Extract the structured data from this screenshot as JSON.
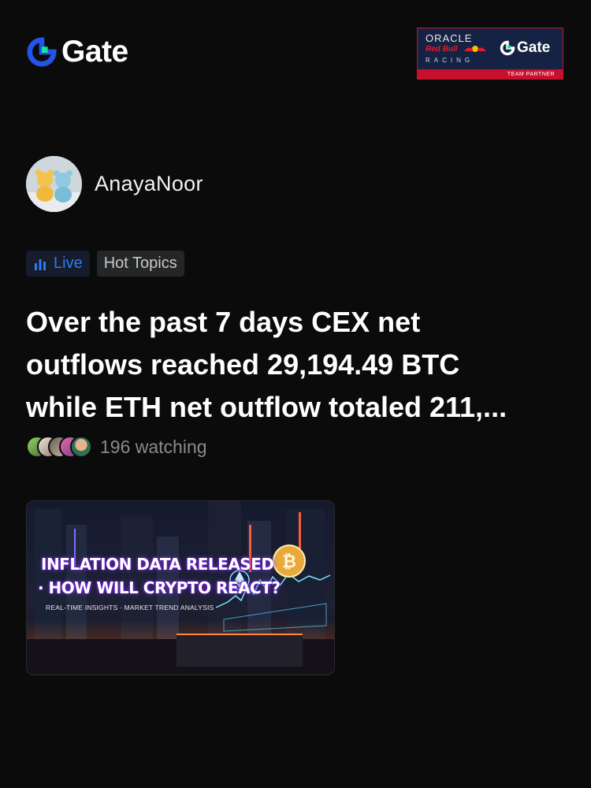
{
  "brand": {
    "name": "Gate"
  },
  "partner_badge": {
    "oracle": "ORACLE",
    "redbull": "Red Bull",
    "racing": "RACING",
    "gate": "Gate",
    "label": "TEAM PARTNER",
    "colors": {
      "background": "#152243",
      "accent": "#c8102e"
    }
  },
  "author": {
    "name": "AnayaNoor"
  },
  "tags": [
    {
      "label": "Live",
      "icon": "bar-chart-icon",
      "color": "#2f7bf0"
    },
    {
      "label": "Hot Topics"
    }
  ],
  "post": {
    "title": "Over the past 7 days CEX net\noutflows reached 29,194.49 BTC\nwhile ETH net outflow totaled 211,..."
  },
  "watching": {
    "text": "196 watching"
  },
  "thumbnail": {
    "headline_line1": "INFLATION DATA RELEASED",
    "headline_line2": "· HOW WILL CRYPTO REACT?",
    "subtitle": "REAL-TIME INSIGHTS · MARKET TREND ANALYSIS",
    "icons": [
      "ethereum-icon",
      "bitcoin-icon"
    ]
  },
  "colors": {
    "background": "#0b0b0c",
    "brand_blue": "#2354e6",
    "brand_cyan": "#17e6a1"
  }
}
